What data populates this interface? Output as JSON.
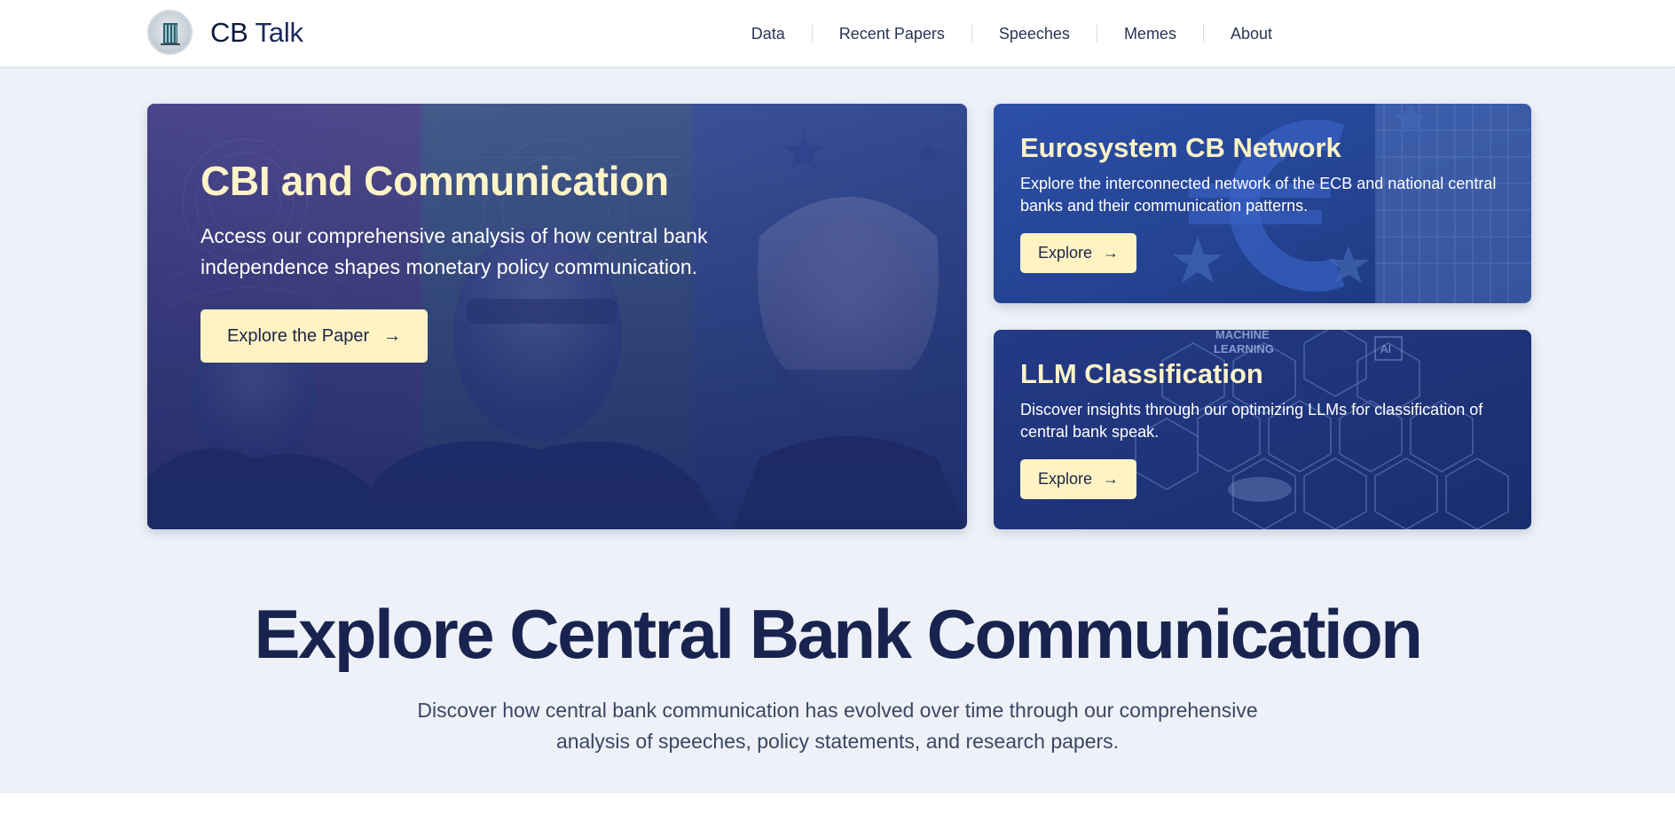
{
  "brand": {
    "cb": "CB",
    "talk": "Talk"
  },
  "nav": [
    {
      "label": "Data"
    },
    {
      "label": "Recent Papers"
    },
    {
      "label": "Speeches"
    },
    {
      "label": "Memes"
    },
    {
      "label": "About"
    }
  ],
  "hero": {
    "title": "CBI and Communication",
    "description": "Access our comprehensive analysis of how central bank independence shapes monetary policy communication.",
    "button_label": "Explore the Paper",
    "arrow": "→"
  },
  "cards": [
    {
      "title": "Eurosystem CB Network",
      "description": "Explore the interconnected network of the ECB and national central banks and their communication patterns.",
      "button_label": "Explore",
      "arrow": "→"
    },
    {
      "title": "LLM Classification",
      "description": "Discover insights through our optimizing LLMs for classification of central bank speak.",
      "button_label": "Explore",
      "arrow": "→",
      "bg_text": {
        "machine": "MACHINE",
        "learning": "LEARNING",
        "ai": "AI"
      }
    }
  ],
  "section": {
    "title": "Explore Central Bank Communication",
    "description_line1": "Discover how central bank communication has evolved over time through our comprehensive",
    "description_line2": "analysis of speeches, policy statements, and research papers."
  },
  "colors": {
    "accent": "#fff3c4",
    "navy": "#18244f",
    "background": "#eef2f8"
  }
}
